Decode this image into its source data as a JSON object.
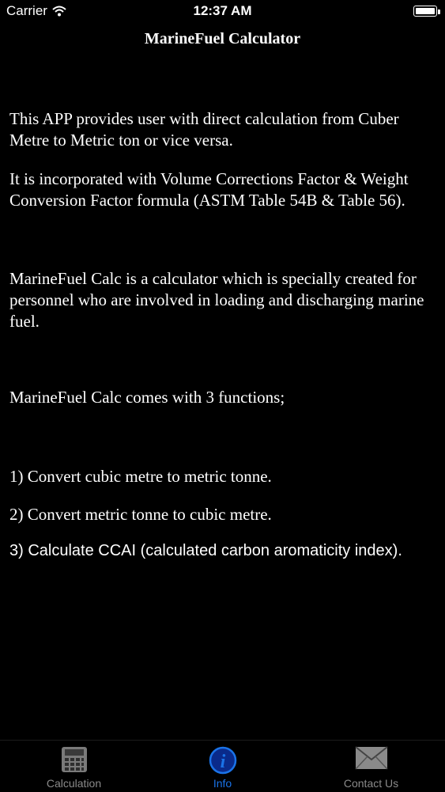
{
  "status": {
    "carrier": "Carrier",
    "time": "12:37 AM"
  },
  "title": "MarineFuel Calculator",
  "paragraphs": {
    "p1": "This APP provides user with direct calculation from Cuber Metre to Metric ton or vice versa.",
    "p2": "It is incorporated with Volume Corrections Factor & Weight Conversion Factor formula (ASTM Table 54B & Table 56).",
    "p3": "MarineFuel Calc is a calculator which is specially created for personnel who are involved in loading and discharging marine fuel.",
    "p4": "MarineFuel Calc comes with 3 functions;",
    "f1": "1) Convert cubic metre to metric tonne.",
    "f2": "2) Convert metric tonne to cubic metre.",
    "f3": "3) Calculate CCAI (calculated carbon aromaticity index)."
  },
  "tabs": {
    "calculation": {
      "label": "Calculation",
      "icon": "calculator-icon"
    },
    "info": {
      "label": "Info",
      "icon": "info-icon"
    },
    "contact": {
      "label": "Contact Us",
      "icon": "mail-icon"
    }
  },
  "colors": {
    "background": "#000000",
    "text": "#ffffff",
    "active_tab": "#1a73e8",
    "inactive_tab": "#8a8a8a"
  }
}
